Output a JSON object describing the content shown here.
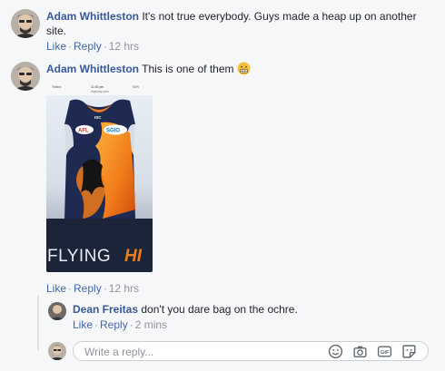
{
  "comments": [
    {
      "author": "Adam Whittleston",
      "text_line1": "It's not true everybody. Guys made a heap up on another",
      "text_line2": "site.",
      "like": "Like",
      "reply": "Reply",
      "time": "12 hrs"
    },
    {
      "author": "Adam Whittleston",
      "text": "This is one of them",
      "emoji": "grimacing-face-icon",
      "image": {
        "status_carrier": "Telstra",
        "status_time": "11:40 pm",
        "status_battery": "54%",
        "url": "bigfooty.com",
        "brand": "ISC",
        "sponsor_left": "AFL",
        "sponsor_right": "SGIO",
        "caption_white": "FLYING",
        "caption_orange": "HI"
      },
      "like": "Like",
      "reply": "Reply",
      "time": "12 hrs"
    }
  ],
  "reply": {
    "author": "Dean Freitas",
    "text": "don't you dare bag on the ochre.",
    "like": "Like",
    "reply": "Reply",
    "time": "2 mins"
  },
  "composer": {
    "placeholder": "Write a reply...",
    "icons": [
      "emoji-icon",
      "camera-icon",
      "gif-icon",
      "sticker-icon"
    ]
  },
  "colors": {
    "link": "#4267b2",
    "author": "#385898",
    "meta": "#90949c",
    "jersey_navy": "#1e2a52",
    "jersey_orange": "#f07b1a",
    "caption_orange": "#f07b1a"
  }
}
